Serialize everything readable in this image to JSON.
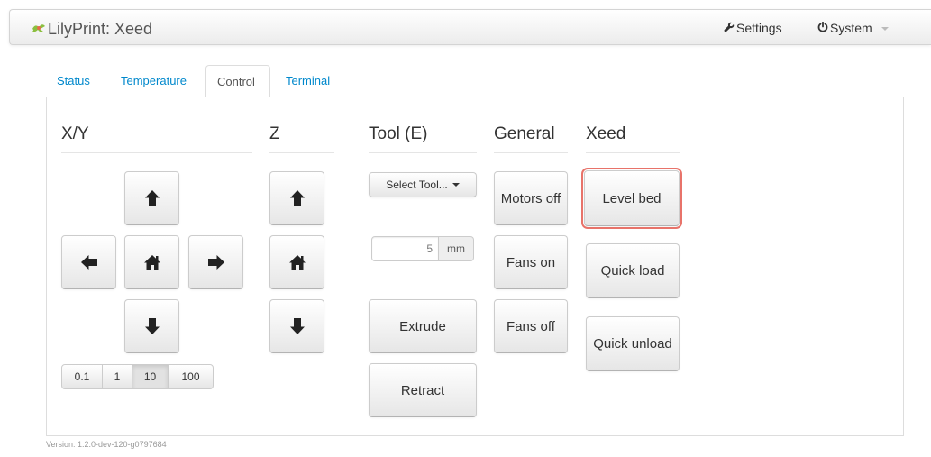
{
  "navbar": {
    "brand": "LilyPrint: Xeed",
    "logo_icon": "lily-logo-icon",
    "settings_label": "Settings",
    "system_label": "System"
  },
  "tabs": [
    {
      "label": "Status",
      "active": false
    },
    {
      "label": "Temperature",
      "active": false
    },
    {
      "label": "Control",
      "active": true
    },
    {
      "label": "Terminal",
      "active": false
    }
  ],
  "control": {
    "xy": {
      "heading": "X/Y",
      "icons": [
        "arrow-up-icon",
        "arrow-left-icon",
        "home-icon",
        "arrow-right-icon",
        "arrow-down-icon"
      ],
      "step_sizes": [
        "0.1",
        "1",
        "10",
        "100"
      ],
      "selected_step": "10"
    },
    "z": {
      "heading": "Z",
      "icons": [
        "arrow-up-icon",
        "home-icon",
        "arrow-down-icon"
      ]
    },
    "tool": {
      "heading": "Tool (E)",
      "select_label": "Select Tool...",
      "amount_value": "5",
      "amount_unit": "mm",
      "extrude_label": "Extrude",
      "retract_label": "Retract"
    },
    "general": {
      "heading": "General",
      "motors_off_label": "Motors off",
      "fans_on_label": "Fans on",
      "fans_off_label": "Fans off"
    },
    "xeed": {
      "heading": "Xeed",
      "level_bed_label": "Level bed",
      "quick_load_label": "Quick load",
      "quick_unload_label": "Quick unload"
    }
  },
  "footer": {
    "version": "Version: 1.2.0-dev-120-g0797684"
  },
  "colors": {
    "link": "#0088cc",
    "highlight": "#e8736a"
  }
}
